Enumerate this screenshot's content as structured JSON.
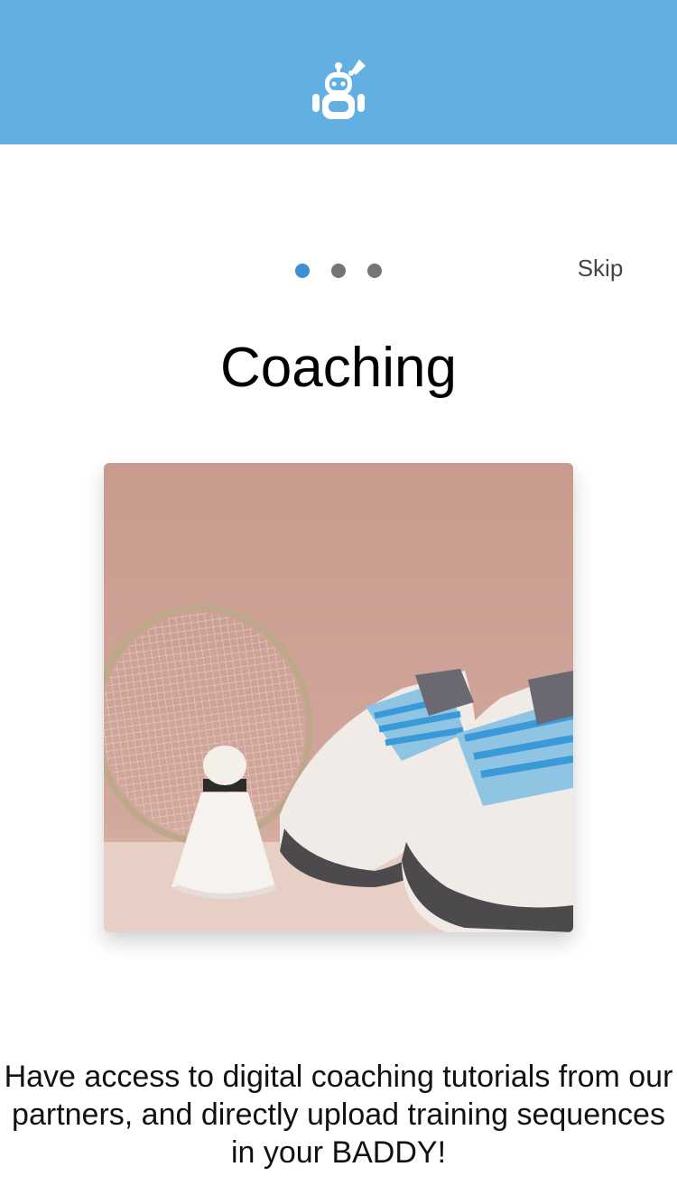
{
  "header": {
    "background_color": "#62b0e2",
    "logo_icon": "robot-badminton-icon"
  },
  "pager": {
    "dots": [
      {
        "active": true,
        "color": "#3d8fd6"
      },
      {
        "active": false,
        "color": "#757575"
      },
      {
        "active": false,
        "color": "#757575"
      }
    ],
    "skip_label": "Skip"
  },
  "slide": {
    "title": "Coaching",
    "image": "badminton-racket-shuttlecock-sneakers-photo",
    "description": "Have access to digital coaching tutorials from our partners, and directly upload training sequences in your BADDY!"
  }
}
